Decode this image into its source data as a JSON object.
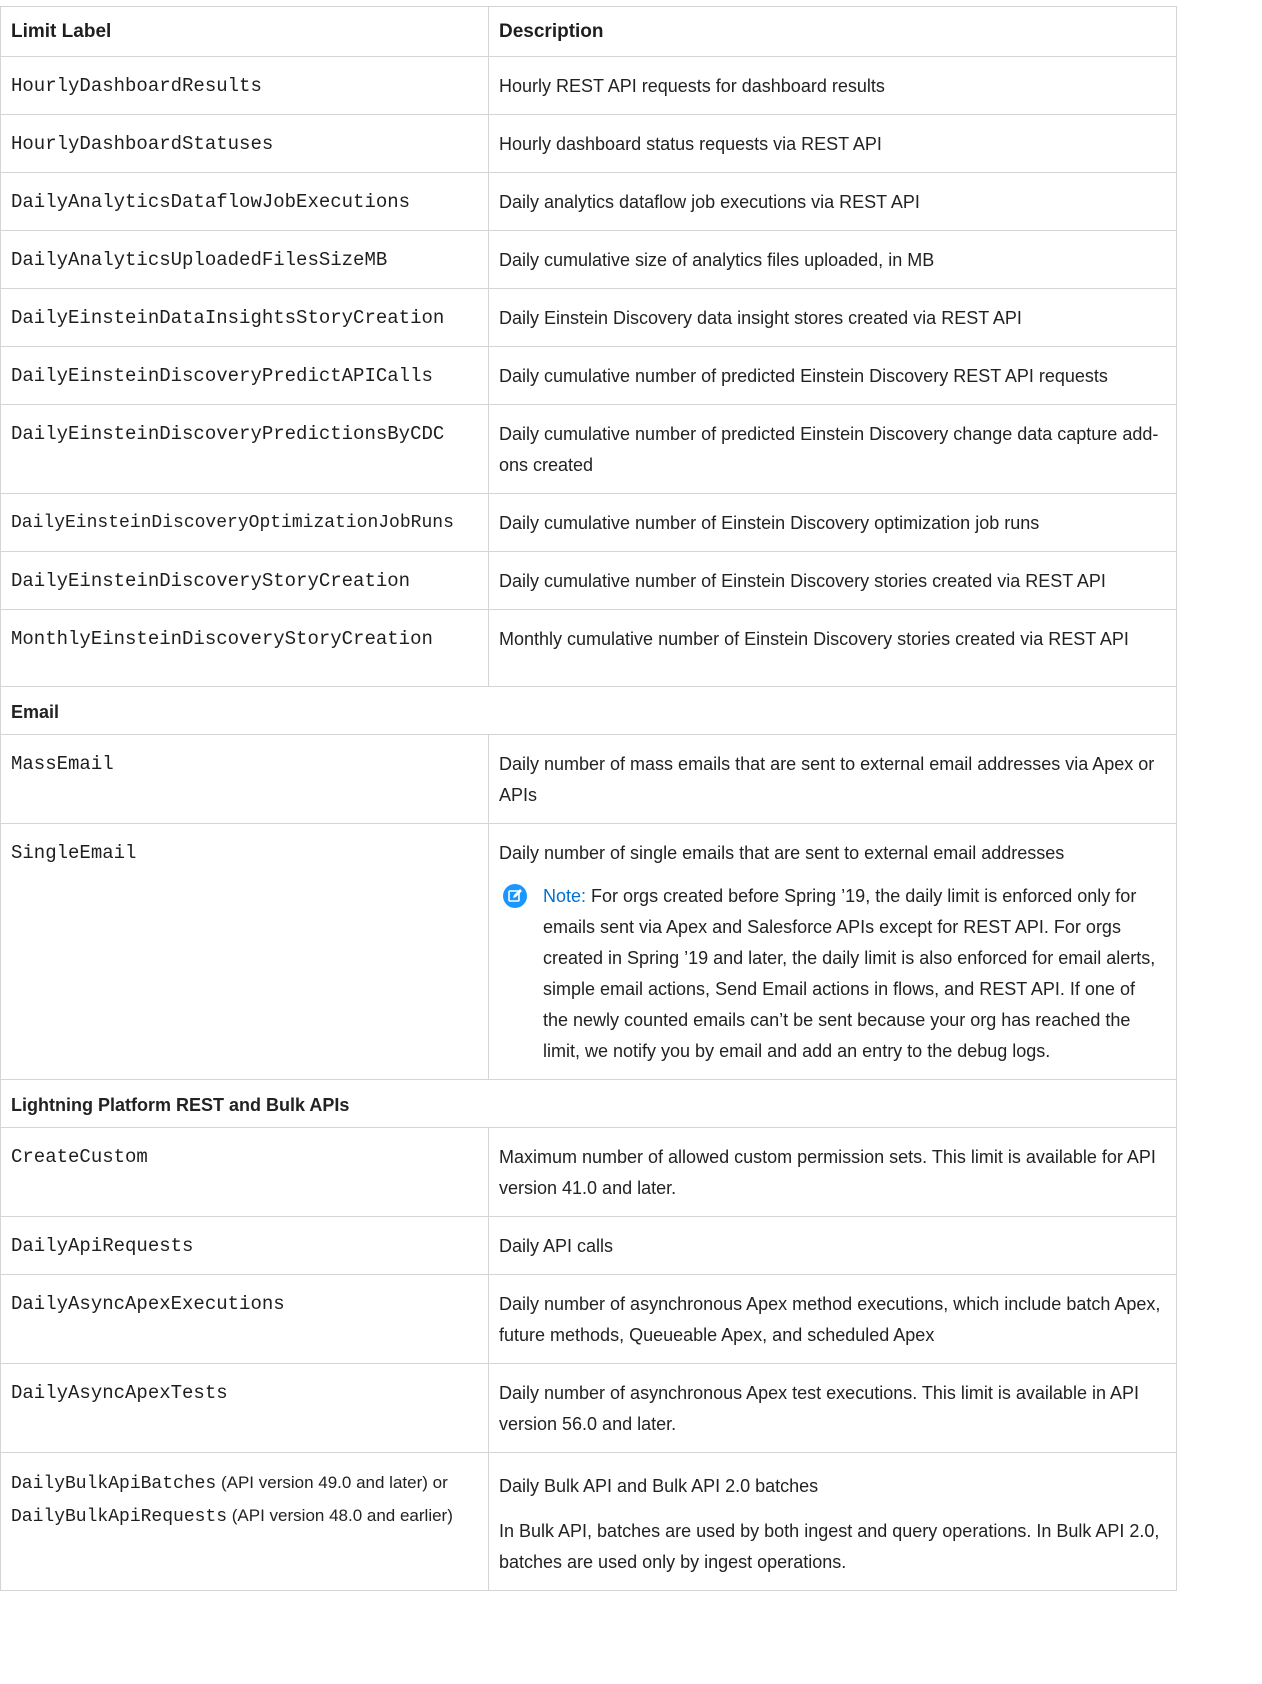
{
  "header": {
    "col1": "Limit Label",
    "col2": "Description"
  },
  "rows_a": [
    {
      "label": "HourlyDashboardResults",
      "desc": "Hourly REST API requests for dashboard results"
    },
    {
      "label": "HourlyDashboardStatuses",
      "desc": "Hourly dashboard status requests via REST API"
    },
    {
      "label": "DailyAnalyticsDataflowJobExecutions",
      "desc": "Daily analytics dataflow job executions via REST API"
    },
    {
      "label": "DailyAnalyticsUploadedFilesSizeMB",
      "desc": "Daily cumulative size of analytics files uploaded, in MB"
    },
    {
      "label": "DailyEinsteinDataInsightsStoryCreation",
      "desc": "Daily Einstein Discovery data insight stores created via REST API"
    },
    {
      "label": "DailyEinsteinDiscoveryPredictAPICalls",
      "desc": "Daily cumulative number of predicted Einstein Discovery REST API requests"
    },
    {
      "label": "DailyEinsteinDiscoveryPredictionsByCDC",
      "desc": "Daily cumulative number of predicted Einstein Discovery change data capture add-ons created"
    },
    {
      "label": "DailyEinsteinDiscoveryOptimizationJobRuns",
      "desc": "Daily cumulative number of Einstein Discovery optimization job runs"
    },
    {
      "label": "DailyEinsteinDiscoveryStoryCreation",
      "desc": "Daily cumulative number of Einstein Discovery stories created via REST API"
    },
    {
      "label": "MonthlyEinsteinDiscoveryStoryCreation",
      "desc": "Monthly cumulative number of Einstein Discovery stories created via REST API"
    }
  ],
  "section_email": "Email",
  "email_rows": [
    {
      "label": "MassEmail",
      "desc": "Daily number of mass emails that are sent to external email addresses via Apex or APIs"
    },
    {
      "label": "SingleEmail",
      "desc": "Daily number of single emails that are sent to external email addresses"
    }
  ],
  "note": {
    "label": "Note:",
    "text": "For orgs created before Spring ’19, the daily limit is enforced only for emails sent via Apex and Salesforce APIs except for REST API. For orgs created in Spring ’19 and later, the daily limit is also enforced for email alerts, simple email actions, Send Email actions in flows, and REST API. If one of the newly counted emails can’t be sent because your org has reached the limit, we notify you by email and add an entry to the debug logs.",
    "icon": "edit-note-icon",
    "icon_color": "#1b96ff"
  },
  "section_rest": "Lightning Platform REST and Bulk APIs",
  "rest_rows": [
    {
      "label": "CreateCustom",
      "desc": "Maximum number of allowed custom permission sets. This limit is available for API version 41.0 and later."
    },
    {
      "label": "DailyApiRequests",
      "desc": "Daily API calls"
    },
    {
      "label": "DailyAsyncApexExecutions",
      "desc": "Daily number of asynchronous Apex method executions, which include batch Apex, future methods, Queueable Apex, and scheduled Apex"
    },
    {
      "label": "DailyAsyncApexTests",
      "desc": "Daily number of asynchronous Apex test executions. This limit is available in API version 56.0 and later."
    }
  ],
  "bulk_row": {
    "label_a": "DailyBulkApiBatches",
    "label_a_note": " (API version 49.0 and later) or ",
    "label_b": "DailyBulkApiRequests",
    "label_b_note": " (API version 48.0 and earlier)",
    "desc": "Daily Bulk API and Bulk API 2.0 batches",
    "desc_2": "In Bulk API, batches are used by both ingest and query operations. In Bulk API 2.0, batches are used only by ingest operations."
  }
}
